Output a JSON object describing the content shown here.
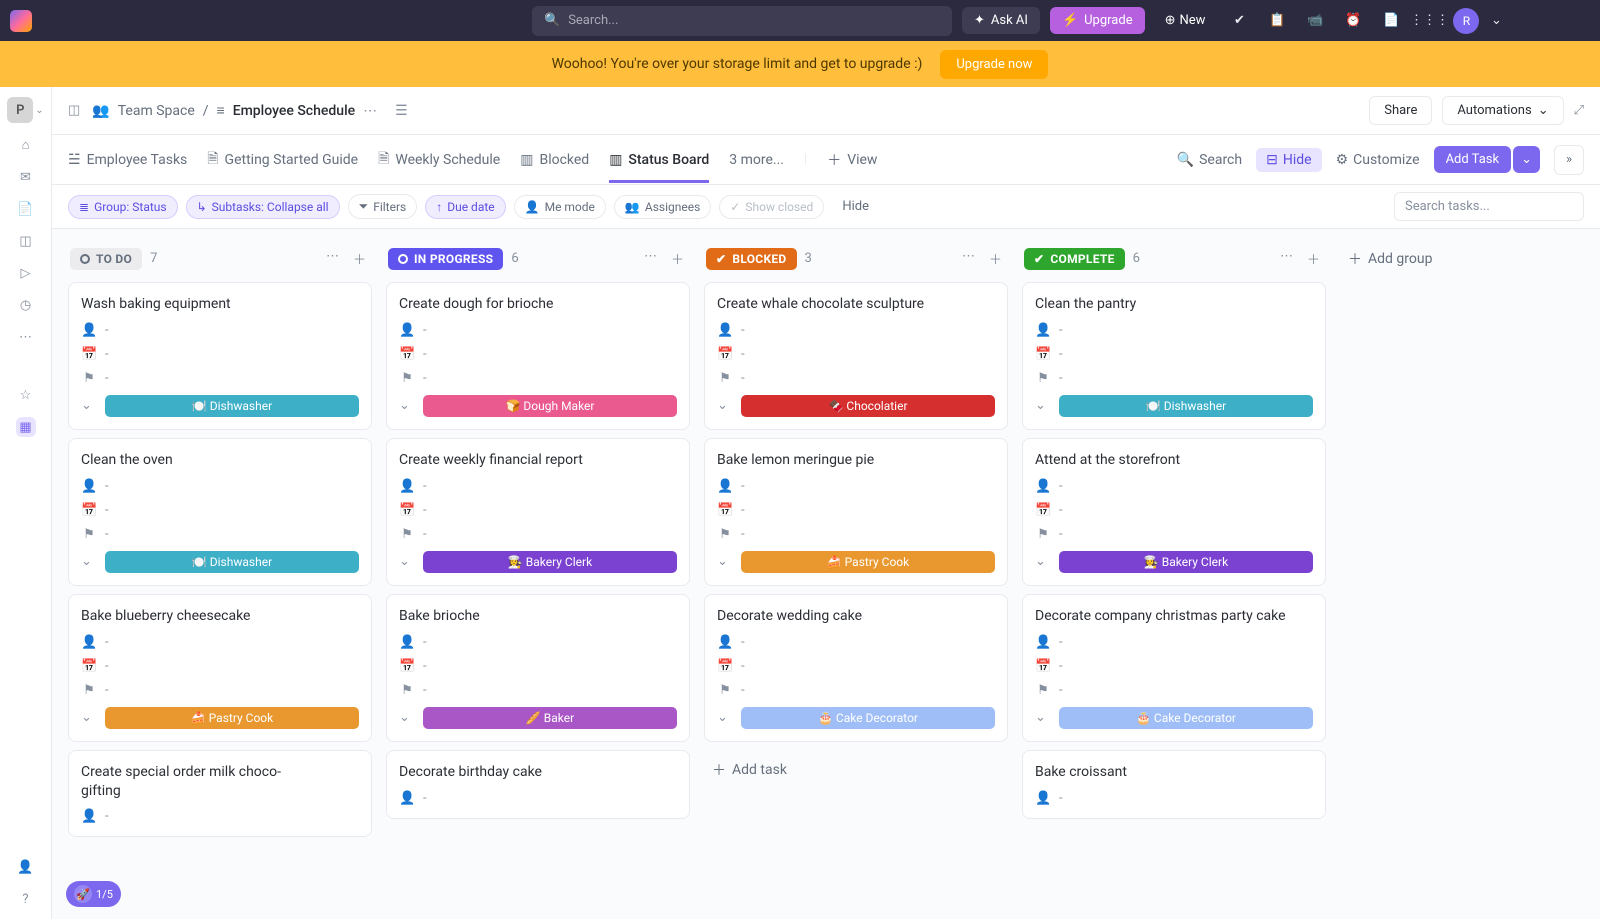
{
  "topbar": {
    "search_placeholder": "Search...",
    "ask_ai": "Ask AI",
    "upgrade": "Upgrade",
    "new": "New",
    "avatar_initial": "R"
  },
  "banner": {
    "text": "Woohoo! You're over your storage limit and get to upgrade :)",
    "button": "Upgrade now"
  },
  "breadcrumb": {
    "workspace_initial": "P",
    "space": "Team Space",
    "folder": "Employee Schedule",
    "share": "Share",
    "automations": "Automations"
  },
  "views": {
    "tabs": [
      "Employee Tasks",
      "Getting Started Guide",
      "Weekly Schedule",
      "Blocked",
      "Status Board"
    ],
    "more": "3 more...",
    "view": "View",
    "search": "Search",
    "hide": "Hide",
    "customize": "Customize",
    "add_task": "Add Task"
  },
  "filters": {
    "group": "Group: Status",
    "subtasks": "Subtasks: Collapse all",
    "filters": "Filters",
    "due_date": "Due date",
    "me_mode": "Me mode",
    "assignees": "Assignees",
    "show_closed": "Show closed",
    "hide": "Hide",
    "search_tasks_placeholder": "Search tasks..."
  },
  "board": {
    "add_group": "Add group",
    "add_task": "Add task",
    "columns": [
      {
        "id": "todo",
        "label": "TO DO",
        "count": 7,
        "style": "todo",
        "cards": [
          {
            "title": "Wash baking equipment",
            "tag": "🍽️ Dishwasher",
            "tag_color": "#3db0c8"
          },
          {
            "title": "Clean the oven",
            "tag": "🍽️ Dishwasher",
            "tag_color": "#3db0c8"
          },
          {
            "title": "Bake blueberry cheesecake",
            "tag": "🍰 Pastry Cook",
            "tag_color": "#e8982e"
          },
          {
            "title": "Create special order milk choco-\n gifting",
            "tag": null,
            "tag_color": null,
            "partial": true
          }
        ]
      },
      {
        "id": "progress",
        "label": "IN PROGRESS",
        "count": 6,
        "style": "progress",
        "cards": [
          {
            "title": "Create dough for brioche",
            "tag": "🍞 Dough Maker",
            "tag_color": "#ea5a8f"
          },
          {
            "title": "Create weekly financial report",
            "tag": "👩‍🍳 Bakery Clerk",
            "tag_color": "#7b42d1"
          },
          {
            "title": "Bake brioche",
            "tag": "🥖 Baker",
            "tag_color": "#a957c6"
          },
          {
            "title": "Decorate birthday cake",
            "tag": null,
            "tag_color": null,
            "partial": true
          }
        ]
      },
      {
        "id": "blocked",
        "label": "BLOCKED",
        "count": 3,
        "style": "blocked",
        "cards": [
          {
            "title": "Create whale chocolate sculpture",
            "tag": "🍫 Chocolatier",
            "tag_color": "#d62f2f"
          },
          {
            "title": "Bake lemon meringue pie",
            "tag": "🍰 Pastry Cook",
            "tag_color": "#e8982e"
          },
          {
            "title": "Decorate wedding cake",
            "tag": "🎂 Cake Decorator",
            "tag_color": "#9fbef7"
          }
        ],
        "show_add_task": true
      },
      {
        "id": "complete",
        "label": "COMPLETE",
        "count": 6,
        "style": "complete",
        "cards": [
          {
            "title": "Clean the pantry",
            "tag": "🍽️ Dishwasher",
            "tag_color": "#3db0c8"
          },
          {
            "title": "Attend at the storefront",
            "tag": "👩‍🍳 Bakery Clerk",
            "tag_color": "#7b42d1"
          },
          {
            "title": "Decorate company christmas party cake",
            "tag": "🎂 Cake Decorator",
            "tag_color": "#9fbef7"
          },
          {
            "title": "Bake croissant",
            "tag": null,
            "tag_color": null,
            "partial": true
          }
        ]
      }
    ]
  },
  "progress_pill": "1/5"
}
